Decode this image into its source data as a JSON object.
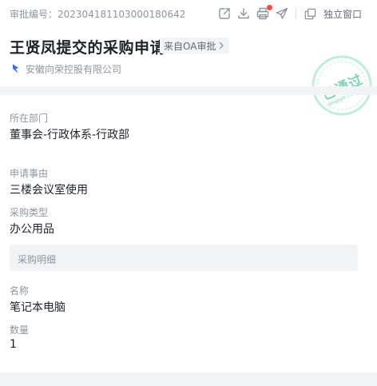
{
  "header": {
    "serial_label": "审批编号：",
    "serial_number": "202304181103000180642",
    "icons": [
      "share-icon",
      "download-icon",
      "print-icon",
      "send-icon",
      "standalone-window-icon"
    ],
    "standalone_label": "独立窗口",
    "notification_color": "#f54a45"
  },
  "approval": {
    "title": "王贤凤提交的采购申请",
    "source_tag": "来自OA审批",
    "company": "安徽向荣控股有限公司",
    "status_stamp": "已通过",
    "stamp_subtext": "dingtalk.com",
    "stamp_color": "#7bd6b0"
  },
  "fields": {
    "department": {
      "label": "所在部门",
      "value": "董事会-行政体系-行政部"
    },
    "reason": {
      "label": "申请事由",
      "value": "三楼会议室使用"
    },
    "purchase_type": {
      "label": "采购类型",
      "value": "办公用品"
    }
  },
  "details": {
    "section_label": "采购明细",
    "name": {
      "label": "名称",
      "value": "笔记本电脑"
    },
    "quantity": {
      "label": "数量",
      "value": "1"
    }
  }
}
